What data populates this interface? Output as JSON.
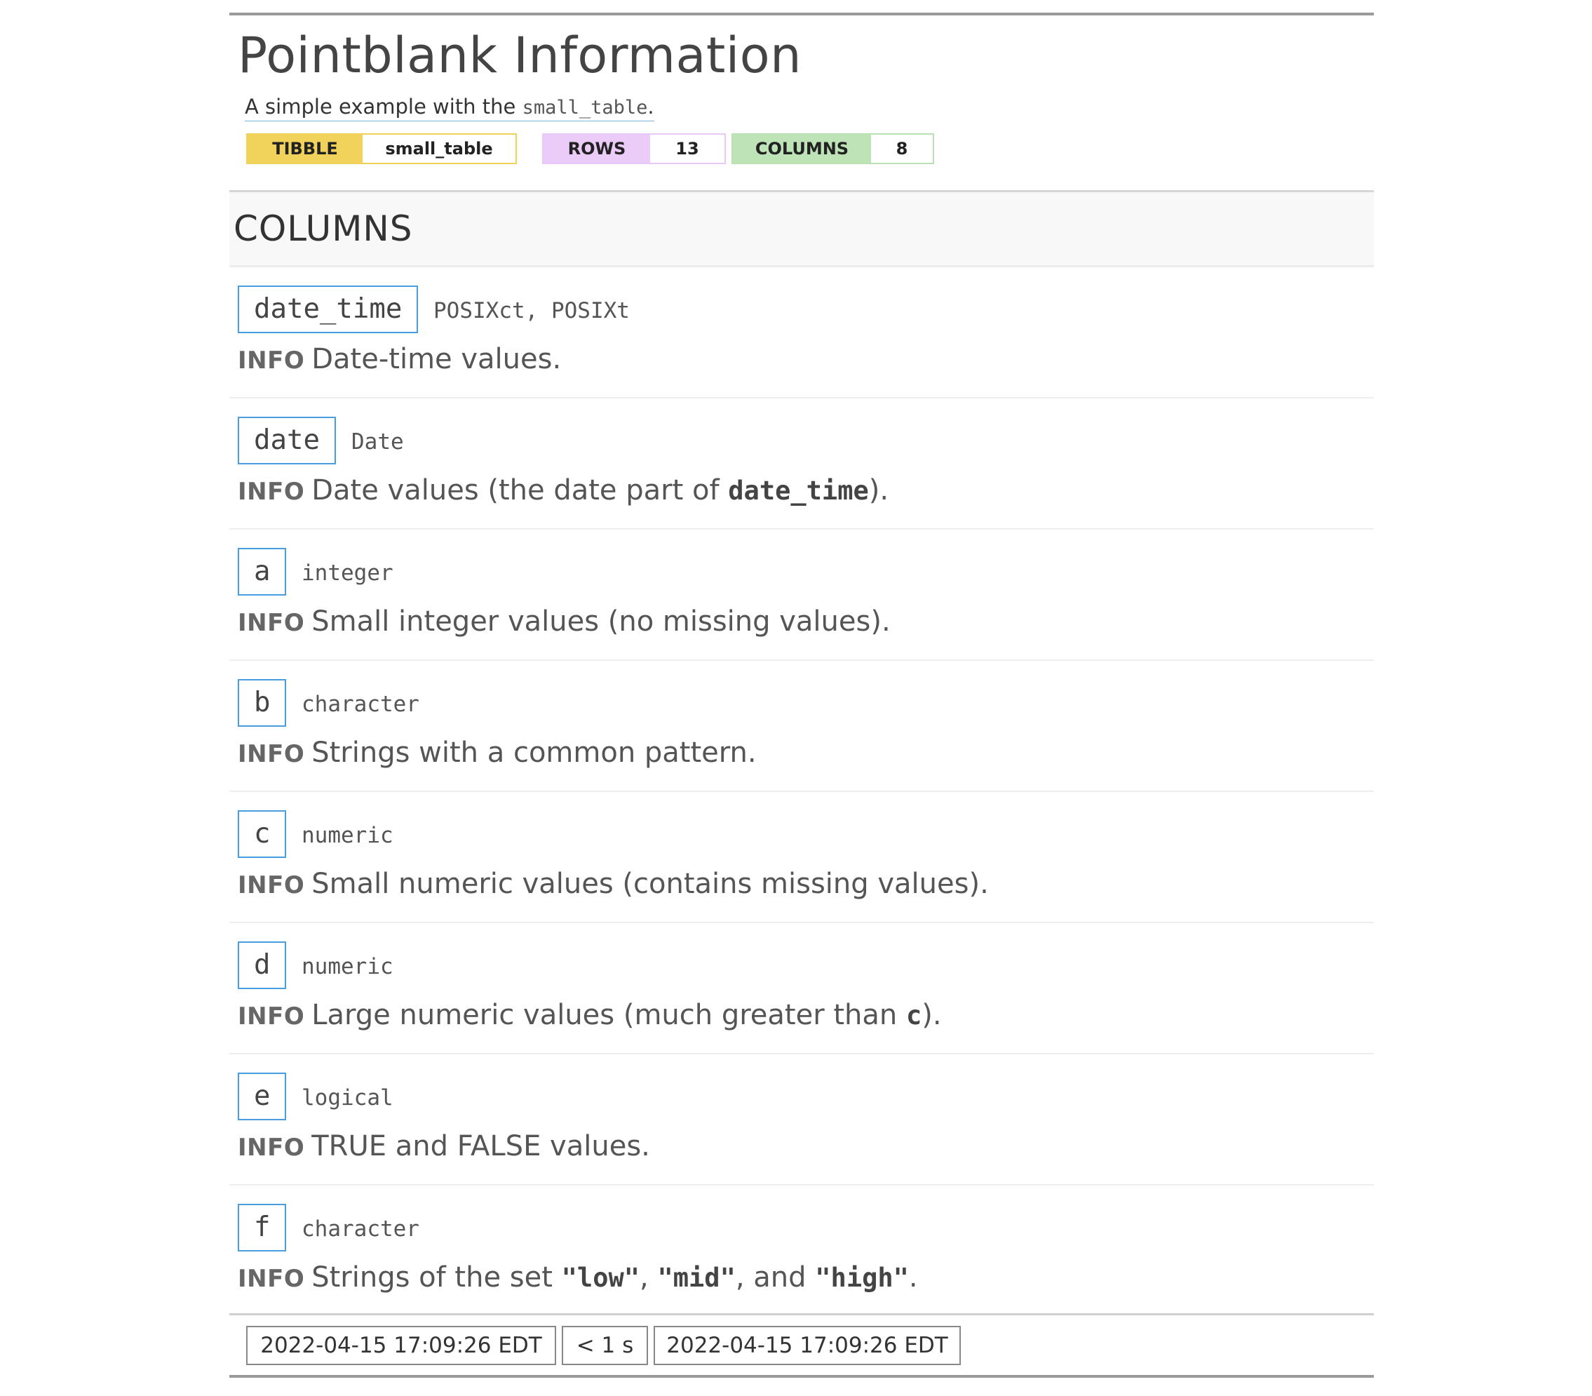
{
  "report": {
    "title": "Pointblank Information",
    "subtitle_prefix": "A simple example with the ",
    "subtitle_code": "small_table",
    "subtitle_suffix": "."
  },
  "badges": {
    "table_type_label": "TIBBLE",
    "table_name": "small_table",
    "rows_label": "ROWS",
    "rows_value": "13",
    "columns_label": "COLUMNS",
    "columns_value": "8"
  },
  "section": {
    "heading": "COLUMNS"
  },
  "columns": [
    {
      "name": "date_time",
      "type": "POSIXct, POSIXt",
      "info_tag": "INFO",
      "info": [
        "Date-time values."
      ]
    },
    {
      "name": "date",
      "type": "Date",
      "info_tag": "INFO",
      "info": [
        "Date values (the date part of ",
        "date_time",
        ")."
      ]
    },
    {
      "name": "a",
      "type": "integer",
      "info_tag": "INFO",
      "info": [
        "Small integer values (no missing values)."
      ]
    },
    {
      "name": "b",
      "type": "character",
      "info_tag": "INFO",
      "info": [
        "Strings with a common pattern."
      ]
    },
    {
      "name": "c",
      "type": "numeric",
      "info_tag": "INFO",
      "info": [
        "Small numeric values (contains missing values)."
      ]
    },
    {
      "name": "d",
      "type": "numeric",
      "info_tag": "INFO",
      "info": [
        "Large numeric values (much greater than ",
        "c",
        ")."
      ]
    },
    {
      "name": "e",
      "type": "logical",
      "info_tag": "INFO",
      "info": [
        "TRUE and FALSE values."
      ]
    },
    {
      "name": "f",
      "type": "character",
      "info_tag": "INFO",
      "info": [
        "Strings of the set ",
        "\"low\"",
        ", ",
        "\"mid\"",
        ", and ",
        "\"high\"",
        "."
      ]
    }
  ],
  "footer": {
    "start_time": "2022-04-15 17:09:26 EDT",
    "duration": "< 1 s",
    "end_time": "2022-04-15 17:09:26 EDT"
  },
  "colors": {
    "tibble_badge": "#f1d35b",
    "rows_badge": "#ebcbf8",
    "columns_badge": "#bde3b6",
    "column_name_border": "#4a9ee0"
  }
}
